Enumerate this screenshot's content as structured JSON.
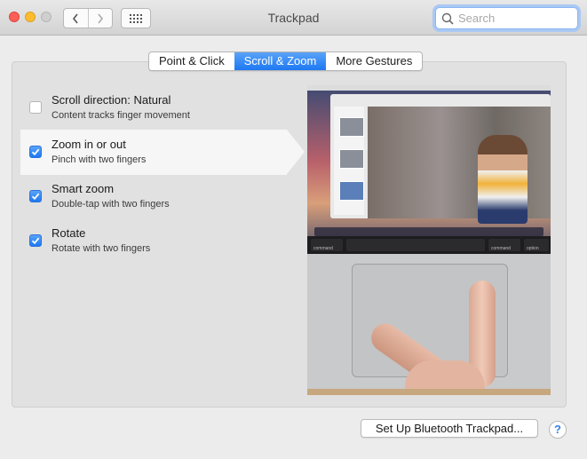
{
  "window": {
    "title": "Trackpad"
  },
  "toolbar": {
    "back_icon": "chevron-left-icon",
    "forward_icon": "chevron-right-icon",
    "show_all_icon": "grid-icon",
    "search_placeholder": "Search",
    "search_value": ""
  },
  "tabs": [
    {
      "label": "Point & Click",
      "active": false
    },
    {
      "label": "Scroll & Zoom",
      "active": true
    },
    {
      "label": "More Gestures",
      "active": false
    }
  ],
  "options": [
    {
      "title": "Scroll direction: Natural",
      "subtitle": "Content tracks finger movement",
      "checked": false,
      "selected": false
    },
    {
      "title": "Zoom in or out",
      "subtitle": "Pinch with two fingers",
      "checked": true,
      "selected": true
    },
    {
      "title": "Smart zoom",
      "subtitle": "Double-tap with two fingers",
      "checked": true,
      "selected": false
    },
    {
      "title": "Rotate",
      "subtitle": "Rotate with two fingers",
      "checked": true,
      "selected": false
    }
  ],
  "preview": {
    "keys": [
      "command",
      "command",
      "option"
    ]
  },
  "footer": {
    "bluetooth_button": "Set Up Bluetooth Trackpad...",
    "help_button": "?"
  },
  "colors": {
    "accent": "#1d78f2",
    "close": "#fc5f57",
    "minimize": "#fdbc2e"
  }
}
